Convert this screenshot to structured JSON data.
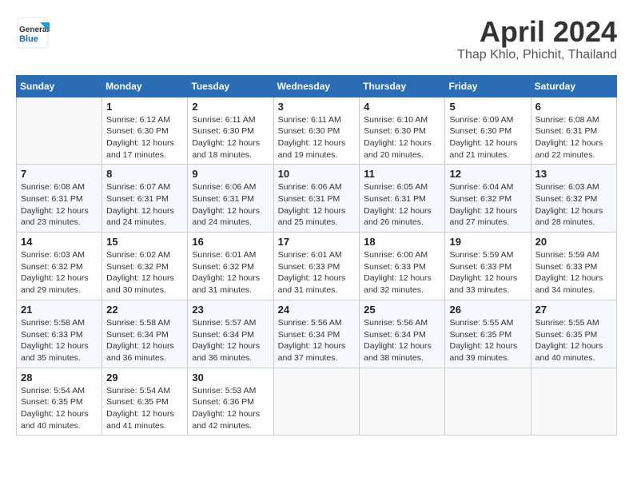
{
  "header": {
    "logo_line1": "General",
    "logo_line2": "Blue",
    "month": "April 2024",
    "location": "Thap Khlo, Phichit, Thailand"
  },
  "days_of_week": [
    "Sunday",
    "Monday",
    "Tuesday",
    "Wednesday",
    "Thursday",
    "Friday",
    "Saturday"
  ],
  "weeks": [
    [
      {
        "day": "",
        "info": ""
      },
      {
        "day": "1",
        "info": "Sunrise: 6:12 AM\nSunset: 6:30 PM\nDaylight: 12 hours\nand 17 minutes."
      },
      {
        "day": "2",
        "info": "Sunrise: 6:11 AM\nSunset: 6:30 PM\nDaylight: 12 hours\nand 18 minutes."
      },
      {
        "day": "3",
        "info": "Sunrise: 6:11 AM\nSunset: 6:30 PM\nDaylight: 12 hours\nand 19 minutes."
      },
      {
        "day": "4",
        "info": "Sunrise: 6:10 AM\nSunset: 6:30 PM\nDaylight: 12 hours\nand 20 minutes."
      },
      {
        "day": "5",
        "info": "Sunrise: 6:09 AM\nSunset: 6:30 PM\nDaylight: 12 hours\nand 21 minutes."
      },
      {
        "day": "6",
        "info": "Sunrise: 6:08 AM\nSunset: 6:31 PM\nDaylight: 12 hours\nand 22 minutes."
      }
    ],
    [
      {
        "day": "7",
        "info": "Sunrise: 6:08 AM\nSunset: 6:31 PM\nDaylight: 12 hours\nand 23 minutes."
      },
      {
        "day": "8",
        "info": "Sunrise: 6:07 AM\nSunset: 6:31 PM\nDaylight: 12 hours\nand 24 minutes."
      },
      {
        "day": "9",
        "info": "Sunrise: 6:06 AM\nSunset: 6:31 PM\nDaylight: 12 hours\nand 24 minutes."
      },
      {
        "day": "10",
        "info": "Sunrise: 6:06 AM\nSunset: 6:31 PM\nDaylight: 12 hours\nand 25 minutes."
      },
      {
        "day": "11",
        "info": "Sunrise: 6:05 AM\nSunset: 6:31 PM\nDaylight: 12 hours\nand 26 minutes."
      },
      {
        "day": "12",
        "info": "Sunrise: 6:04 AM\nSunset: 6:32 PM\nDaylight: 12 hours\nand 27 minutes."
      },
      {
        "day": "13",
        "info": "Sunrise: 6:03 AM\nSunset: 6:32 PM\nDaylight: 12 hours\nand 28 minutes."
      }
    ],
    [
      {
        "day": "14",
        "info": "Sunrise: 6:03 AM\nSunset: 6:32 PM\nDaylight: 12 hours\nand 29 minutes."
      },
      {
        "day": "15",
        "info": "Sunrise: 6:02 AM\nSunset: 6:32 PM\nDaylight: 12 hours\nand 30 minutes."
      },
      {
        "day": "16",
        "info": "Sunrise: 6:01 AM\nSunset: 6:32 PM\nDaylight: 12 hours\nand 31 minutes."
      },
      {
        "day": "17",
        "info": "Sunrise: 6:01 AM\nSunset: 6:33 PM\nDaylight: 12 hours\nand 31 minutes."
      },
      {
        "day": "18",
        "info": "Sunrise: 6:00 AM\nSunset: 6:33 PM\nDaylight: 12 hours\nand 32 minutes."
      },
      {
        "day": "19",
        "info": "Sunrise: 5:59 AM\nSunset: 6:33 PM\nDaylight: 12 hours\nand 33 minutes."
      },
      {
        "day": "20",
        "info": "Sunrise: 5:59 AM\nSunset: 6:33 PM\nDaylight: 12 hours\nand 34 minutes."
      }
    ],
    [
      {
        "day": "21",
        "info": "Sunrise: 5:58 AM\nSunset: 6:33 PM\nDaylight: 12 hours\nand 35 minutes."
      },
      {
        "day": "22",
        "info": "Sunrise: 5:58 AM\nSunset: 6:34 PM\nDaylight: 12 hours\nand 36 minutes."
      },
      {
        "day": "23",
        "info": "Sunrise: 5:57 AM\nSunset: 6:34 PM\nDaylight: 12 hours\nand 36 minutes."
      },
      {
        "day": "24",
        "info": "Sunrise: 5:56 AM\nSunset: 6:34 PM\nDaylight: 12 hours\nand 37 minutes."
      },
      {
        "day": "25",
        "info": "Sunrise: 5:56 AM\nSunset: 6:34 PM\nDaylight: 12 hours\nand 38 minutes."
      },
      {
        "day": "26",
        "info": "Sunrise: 5:55 AM\nSunset: 6:35 PM\nDaylight: 12 hours\nand 39 minutes."
      },
      {
        "day": "27",
        "info": "Sunrise: 5:55 AM\nSunset: 6:35 PM\nDaylight: 12 hours\nand 40 minutes."
      }
    ],
    [
      {
        "day": "28",
        "info": "Sunrise: 5:54 AM\nSunset: 6:35 PM\nDaylight: 12 hours\nand 40 minutes."
      },
      {
        "day": "29",
        "info": "Sunrise: 5:54 AM\nSunset: 6:35 PM\nDaylight: 12 hours\nand 41 minutes."
      },
      {
        "day": "30",
        "info": "Sunrise: 5:53 AM\nSunset: 6:36 PM\nDaylight: 12 hours\nand 42 minutes."
      },
      {
        "day": "",
        "info": ""
      },
      {
        "day": "",
        "info": ""
      },
      {
        "day": "",
        "info": ""
      },
      {
        "day": "",
        "info": ""
      }
    ]
  ]
}
